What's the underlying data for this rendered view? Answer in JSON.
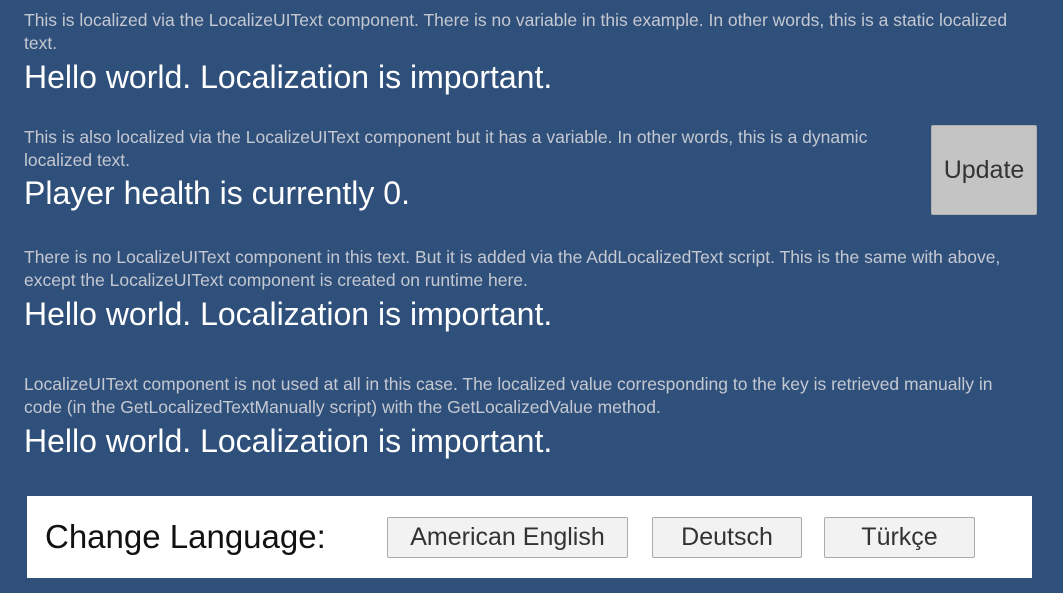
{
  "sections": [
    {
      "desc": "This is localized via the LocalizeUIText component. There is no variable in this example. In other words, this is a static localized text.",
      "text": "Hello world. Localization is important."
    },
    {
      "desc": "This is also localized via the LocalizeUIText component but it has a variable. In other words, this is a dynamic localized text.",
      "text": "Player health is currently 0."
    },
    {
      "desc": "There is no LocalizeUIText component in this text. But it is added via the AddLocalizedText script. This is the same with above, except the LocalizeUIText component is created on runtime here.",
      "text": "Hello world. Localization is important."
    },
    {
      "desc": "LocalizeUIText component is not used at all in this case. The localized value corresponding to the key is retrieved manually in code (in the GetLocalizedTextManually script) with the GetLocalizedValue method.",
      "text": "Hello world. Localization is important."
    }
  ],
  "update_label": "Update",
  "language_panel": {
    "label": "Change Language:",
    "buttons": [
      "American English",
      "Deutsch",
      "Türkçe"
    ]
  }
}
